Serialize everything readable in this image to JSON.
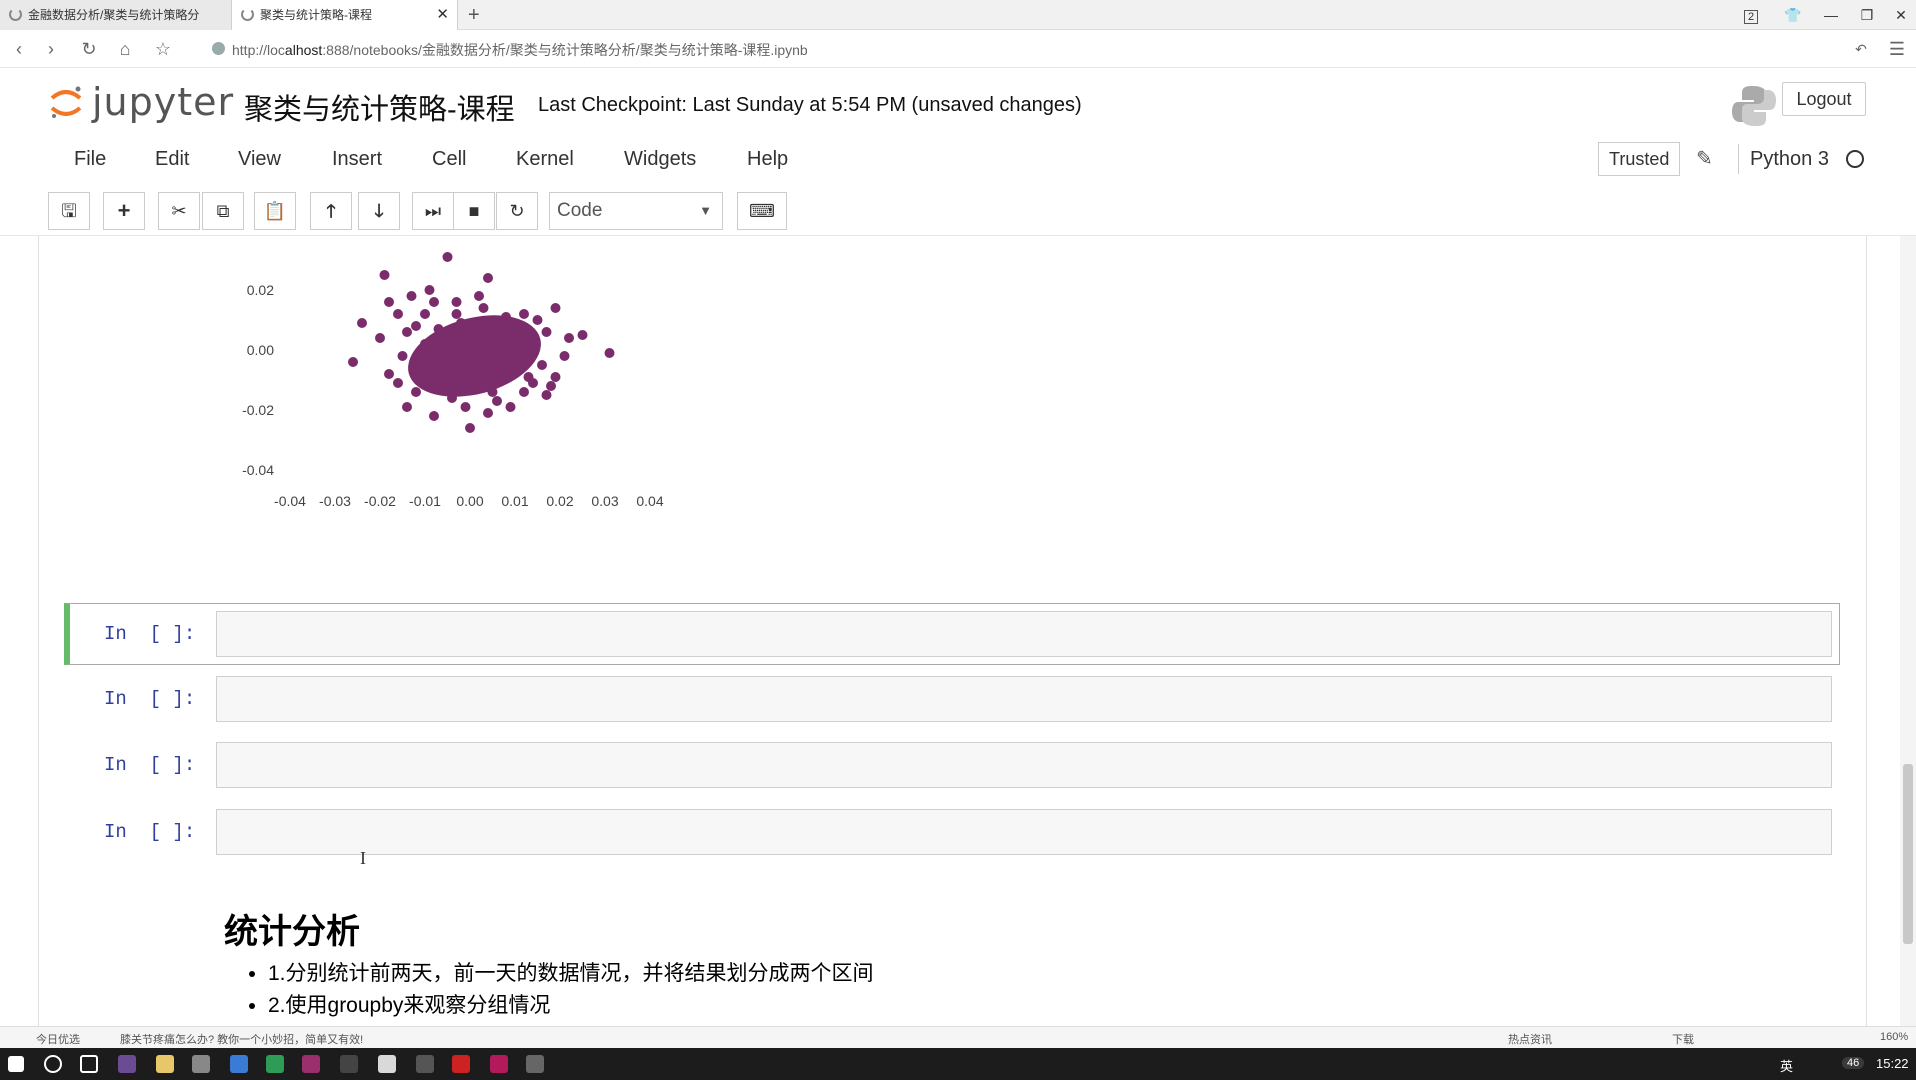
{
  "browser": {
    "tabs": [
      {
        "label": "金融数据分析/聚类与统计策略分"
      },
      {
        "label": "聚类与统计策略-课程"
      }
    ],
    "new_tab": "+",
    "url_prefix": "http://loc",
    "url_host": "alhost",
    "url_rest": ":888/notebooks/金融数据分析/聚类与统计策略分析/聚类与统计策略-课程.ipynb",
    "window_badge": "2"
  },
  "jupyter": {
    "logo_text": "jupyter",
    "notebook_title": "聚类与统计策略-课程",
    "checkpoint": "Last Checkpoint: Last Sunday at 5:54 PM (unsaved changes)",
    "logout_label": "Logout"
  },
  "menubar": {
    "items": [
      "File",
      "Edit",
      "View",
      "Insert",
      "Cell",
      "Kernel",
      "Widgets",
      "Help"
    ],
    "trusted_label": "Trusted",
    "kernel_name": "Python 3"
  },
  "toolbar": {
    "cell_type": "Code",
    "buttons": [
      "save-icon",
      "plus-icon",
      "cut-icon",
      "copy-icon",
      "paste-icon",
      "arrow-up-icon",
      "arrow-down-icon",
      "step-forward-icon",
      "stop-icon",
      "restart-icon",
      "keyboard-icon"
    ]
  },
  "chart_data": {
    "type": "scatter",
    "title": "",
    "xlabel": "",
    "ylabel": "",
    "xlim": [
      -0.04,
      0.04
    ],
    "ylim": [
      -0.04,
      0.04
    ],
    "x_ticks": [
      "-0.04",
      "-0.03",
      "-0.02",
      "-0.01",
      "0.00",
      "0.01",
      "0.02",
      "0.03",
      "0.04"
    ],
    "y_ticks": [
      "0.02",
      "0.00",
      "-0.02",
      "-0.04"
    ],
    "color": "#7b2d6b",
    "points": [
      [
        -0.005,
        0.031
      ],
      [
        -0.019,
        0.025
      ],
      [
        -0.024,
        0.009
      ],
      [
        -0.026,
        -0.004
      ],
      [
        0.031,
        -0.001
      ],
      [
        0.0,
        -0.026
      ],
      [
        0.025,
        0.005
      ],
      [
        0.019,
        0.014
      ],
      [
        -0.014,
        -0.019
      ],
      [
        -0.008,
        -0.022
      ],
      [
        0.004,
        -0.021
      ],
      [
        0.017,
        -0.015
      ],
      [
        0.022,
        0.004
      ],
      [
        0.021,
        -0.002
      ],
      [
        -0.009,
        0.02
      ],
      [
        0.004,
        0.024
      ],
      [
        0.012,
        0.012
      ],
      [
        0.015,
        0.01
      ],
      [
        -0.016,
        0.012
      ],
      [
        -0.02,
        0.004
      ],
      [
        -0.018,
        -0.008
      ],
      [
        -0.012,
        -0.014
      ],
      [
        -0.004,
        -0.016
      ],
      [
        0.006,
        -0.017
      ],
      [
        0.012,
        -0.014
      ],
      [
        0.019,
        -0.009
      ],
      [
        0.016,
        -0.005
      ],
      [
        0.014,
        0.004
      ],
      [
        0.009,
        0.009
      ],
      [
        0.003,
        0.014
      ],
      [
        -0.003,
        0.016
      ],
      [
        -0.01,
        0.012
      ],
      [
        -0.014,
        0.006
      ],
      [
        -0.015,
        -0.002
      ],
      [
        -0.011,
        -0.008
      ],
      [
        -0.006,
        -0.011
      ],
      [
        0.0,
        -0.012
      ],
      [
        0.007,
        -0.01
      ],
      [
        0.011,
        -0.006
      ],
      [
        0.012,
        0.0
      ],
      [
        0.009,
        0.005
      ],
      [
        0.004,
        0.008
      ],
      [
        -0.002,
        0.009
      ],
      [
        -0.007,
        0.007
      ],
      [
        -0.01,
        0.002
      ],
      [
        -0.009,
        -0.004
      ],
      [
        -0.005,
        -0.007
      ],
      [
        0.001,
        -0.007
      ],
      [
        0.006,
        -0.005
      ],
      [
        0.007,
        0.0
      ],
      [
        0.004,
        0.003
      ],
      [
        -0.001,
        0.004
      ],
      [
        -0.005,
        0.002
      ],
      [
        -0.004,
        -0.002
      ],
      [
        0.001,
        -0.002
      ],
      [
        0.003,
        0.001
      ],
      [
        0.0,
        0.0
      ],
      [
        -0.002,
        0.001
      ],
      [
        0.002,
        -0.003
      ],
      [
        0.01,
        -0.003
      ],
      [
        0.013,
        -0.009
      ],
      [
        -0.012,
        0.008
      ],
      [
        0.008,
        0.011
      ],
      [
        -0.007,
        -0.013
      ],
      [
        0.017,
        0.006
      ],
      [
        -0.016,
        -0.011
      ],
      [
        0.005,
        -0.014
      ],
      [
        -0.003,
        0.012
      ],
      [
        0.014,
        -0.011
      ],
      [
        -0.008,
        0.016
      ],
      [
        0.002,
        0.018
      ],
      [
        -0.013,
        0.018
      ],
      [
        0.018,
        -0.012
      ],
      [
        -0.018,
        0.016
      ],
      [
        0.009,
        -0.019
      ],
      [
        -0.001,
        -0.019
      ]
    ]
  },
  "cells": [
    {
      "prompt": "In  [ ]:"
    },
    {
      "prompt": "In  [ ]:"
    },
    {
      "prompt": "In  [ ]:"
    },
    {
      "prompt": "In  [ ]:"
    }
  ],
  "markdown": {
    "heading": "统计分析",
    "items": [
      "1.分别统计前两天，前一天的数据情况，并将结果划分成两个区间",
      "2.使用groupby来观察分组情况"
    ]
  },
  "statusbar": {
    "left1": "今日优选",
    "left2": "膝关节疼痛怎么办? 教你一个小妙招，简单又有效!",
    "news": "热点资讯",
    "download": "下载",
    "zoom": "160%"
  },
  "taskbar": {
    "ime": "英",
    "time": "15:22",
    "badge": "46"
  }
}
